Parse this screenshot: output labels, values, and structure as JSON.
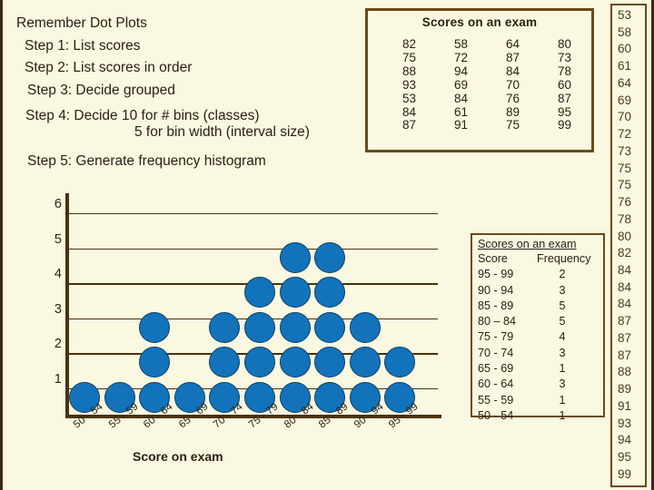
{
  "slide": {
    "background_color": "#FAF8E1",
    "accent_color": "#6b4a18",
    "dot_color": "#1273ba"
  },
  "steps": {
    "heading": "Remember Dot Plots",
    "lines": [
      "Step 1: List scores",
      "Step 2: List scores in order",
      "Step 3: Decide grouped",
      "Step 4: Decide 10 for # bins (classes)",
      "5 for bin width (interval size)",
      "Step 5: Generate frequency histogram"
    ]
  },
  "scores_box": {
    "title": "Scores on an exam",
    "rows": [
      [
        "82",
        "58",
        "64",
        "80"
      ],
      [
        "75",
        "72",
        "87",
        "73"
      ],
      [
        "88",
        "94",
        "84",
        "78"
      ],
      [
        "93",
        "69",
        "70",
        "60"
      ],
      [
        "53",
        "84",
        "76",
        "87"
      ],
      [
        "84",
        "61",
        "89",
        "95"
      ],
      [
        "87",
        "91",
        "75",
        "99"
      ]
    ]
  },
  "freq_table": {
    "title": "Scores on an exam",
    "headers": [
      "Score",
      "Frequency"
    ],
    "rows": [
      [
        "95 - 99",
        "2"
      ],
      [
        "90 - 94",
        "3"
      ],
      [
        "85 - 89",
        "5"
      ],
      [
        "80 – 84",
        "5"
      ],
      [
        "75 - 79",
        "4"
      ],
      [
        "70 - 74",
        "3"
      ],
      [
        "65 - 69",
        "1"
      ],
      [
        "60 - 64",
        "3"
      ],
      [
        "55 - 59",
        "1"
      ],
      [
        "50 - 54",
        "1"
      ]
    ]
  },
  "sorted_scores": [
    "53",
    "58",
    "60",
    "61",
    "64",
    "69",
    "70",
    "72",
    "73",
    "75",
    "75",
    "76",
    "78",
    "80",
    "82",
    "84",
    "84",
    "84",
    "87",
    "87",
    "87",
    "88",
    "89",
    "91",
    "93",
    "94",
    "95",
    "99"
  ],
  "chart_data": {
    "type": "bar",
    "title": "",
    "xlabel": "Score on exam",
    "ylabel": "",
    "categories": [
      "50 - 54",
      "55 - 59",
      "60 - 64",
      "65 - 69",
      "70 - 74",
      "75 - 79",
      "80 - 84",
      "85 - 89",
      "90 - 94",
      "95 - 99"
    ],
    "values": [
      1,
      1,
      3,
      1,
      3,
      4,
      5,
      5,
      3,
      2
    ],
    "ylim": [
      0,
      6
    ],
    "yticks": [
      "1",
      "2",
      "3",
      "4",
      "5",
      "6"
    ],
    "grid": true,
    "legend": "none",
    "marker_style": "stacked-dots"
  }
}
